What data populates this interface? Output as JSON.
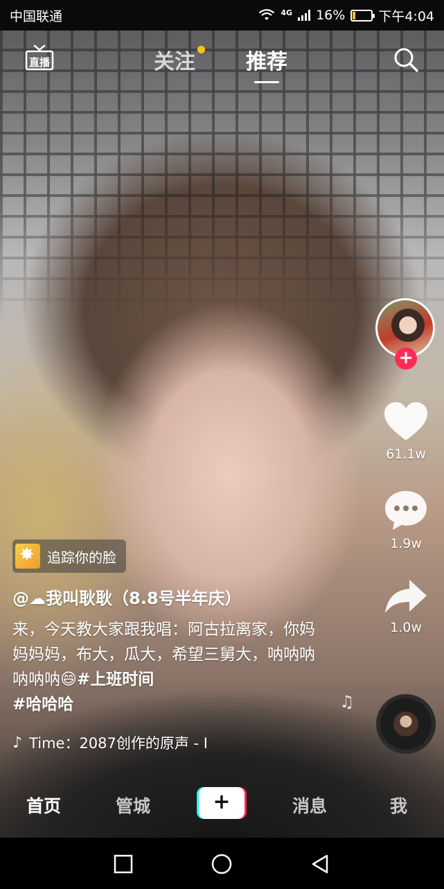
{
  "status_bar": {
    "carrier": "中国联通",
    "network": "4G",
    "battery": "16%",
    "battery_level": 0.16,
    "time": "下午4:04"
  },
  "top_nav": {
    "live_icon_text": "直播",
    "tabs": [
      {
        "label": "关注",
        "active": false,
        "has_dot": true
      },
      {
        "label": "推荐",
        "active": true
      }
    ]
  },
  "effect": {
    "label": "追踪你的脸"
  },
  "video": {
    "username": "@☁我叫耿耿（8.8号半年庆）",
    "description": "来，今天教大家跟我唱：阿古拉离家，你妈妈妈妈，布大，瓜大，希望三舅大，呐呐呐呐呐呐😄",
    "hashtags": [
      "#上班时间",
      "#哈哈哈"
    ],
    "music": "Time：2087创作的原声 - I"
  },
  "actions": {
    "likes": "61.1w",
    "comments": "1.9w",
    "shares": "1.0w"
  },
  "bottom_nav": {
    "home": "首页",
    "mall": "管城",
    "create": "+",
    "messages": "消息",
    "me": "我"
  },
  "colors": {
    "accent_red": "#fe2c55",
    "accent_cyan": "#25f4ee",
    "follow_dot": "#f5c518"
  }
}
